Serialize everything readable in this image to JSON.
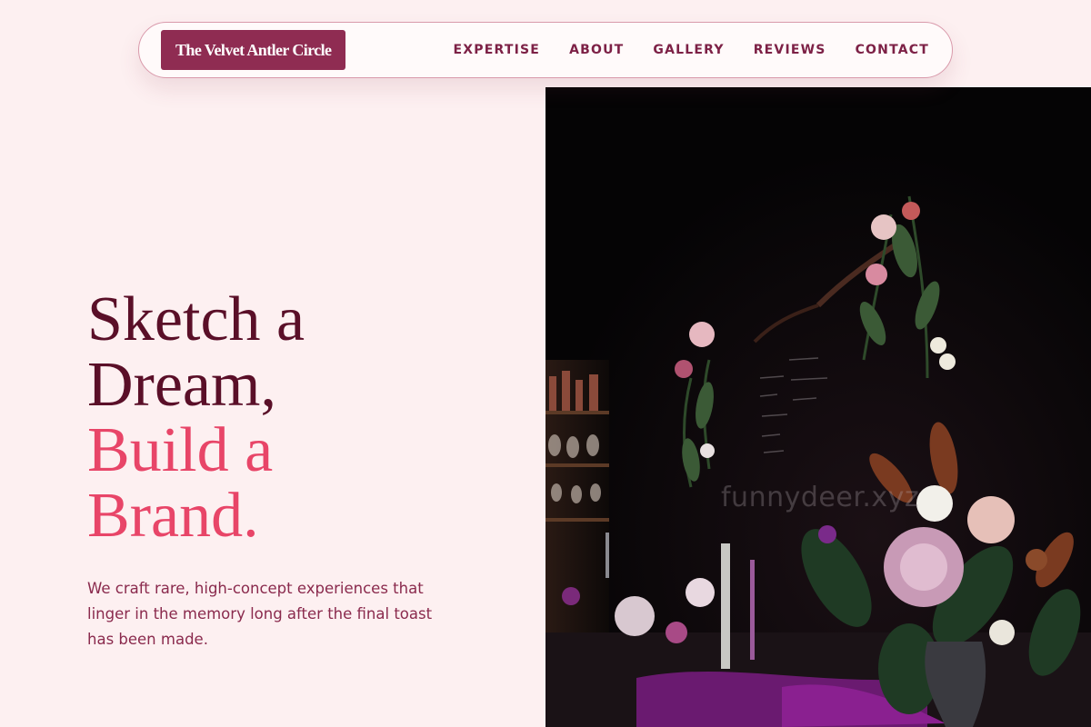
{
  "brand": {
    "name": "The Velvet Antler Circle"
  },
  "nav": {
    "items": [
      {
        "label": "EXPERTISE"
      },
      {
        "label": "ABOUT"
      },
      {
        "label": "GALLERY"
      },
      {
        "label": "REVIEWS"
      },
      {
        "label": "CONTACT"
      }
    ]
  },
  "hero": {
    "headline": {
      "line1": "Sketch a",
      "line2": "Dream,",
      "line3": "Build a",
      "line4": "Brand."
    },
    "subtext": "We craft rare, high-concept experiences that linger in the memory long after the final toast has been made.",
    "image": {
      "icon": "floral-table-photo",
      "watermark": "funnydeer.xyz"
    }
  },
  "colors": {
    "background": "#fdf0f1",
    "brand_bg": "#8f2c52",
    "nav_text": "#7d2146",
    "headline_dark": "#5a0f28",
    "headline_accent": "#e84568",
    "body_text": "#8a2a4d"
  }
}
